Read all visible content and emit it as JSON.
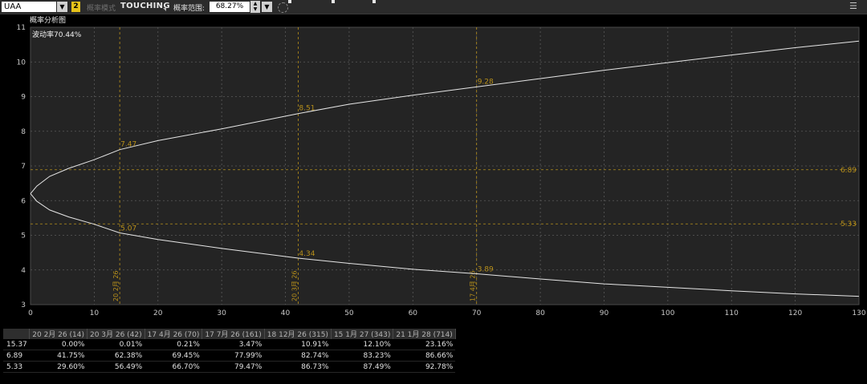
{
  "toolbar": {
    "symbol": "UAA",
    "badge": "2",
    "mode_label": "概率模式",
    "mode_value": "TOUCHING",
    "range_label": "概率范围:",
    "range_value": "68.27%"
  },
  "chart_title": "概率分析图",
  "chart_data": {
    "type": "line",
    "title": "概率分析图",
    "annotation": "波动率70.44%",
    "x_ticks": [
      0,
      10,
      20,
      30,
      40,
      50,
      60,
      70,
      80,
      90,
      100,
      110,
      120,
      130
    ],
    "y_ticks": [
      3,
      4,
      5,
      6,
      7,
      8,
      9,
      10,
      11
    ],
    "xlim": [
      0,
      130
    ],
    "ylim": [
      3,
      11
    ],
    "grid": true,
    "series": [
      {
        "values": [
          [
            0,
            6.2
          ],
          [
            1,
            6.42
          ],
          [
            3,
            6.7
          ],
          [
            6,
            6.93
          ],
          [
            10,
            7.18
          ],
          [
            14,
            7.47
          ],
          [
            20,
            7.73
          ],
          [
            30,
            8.07
          ],
          [
            42,
            8.51
          ],
          [
            50,
            8.78
          ],
          [
            60,
            9.04
          ],
          [
            70,
            9.28
          ],
          [
            80,
            9.52
          ],
          [
            90,
            9.76
          ],
          [
            100,
            9.98
          ],
          [
            110,
            10.2
          ],
          [
            120,
            10.41
          ],
          [
            130,
            10.6
          ]
        ]
      },
      {
        "values": [
          [
            0,
            6.2
          ],
          [
            1,
            5.98
          ],
          [
            3,
            5.73
          ],
          [
            6,
            5.53
          ],
          [
            10,
            5.32
          ],
          [
            14,
            5.07
          ],
          [
            20,
            4.88
          ],
          [
            30,
            4.62
          ],
          [
            42,
            4.34
          ],
          [
            50,
            4.19
          ],
          [
            60,
            4.02
          ],
          [
            70,
            3.89
          ],
          [
            80,
            3.74
          ],
          [
            90,
            3.6
          ],
          [
            100,
            3.5
          ],
          [
            110,
            3.4
          ],
          [
            120,
            3.31
          ],
          [
            130,
            3.24
          ]
        ]
      }
    ],
    "point_labels": [
      {
        "x": 14,
        "y": 7.47,
        "text": "7.47"
      },
      {
        "x": 14,
        "y": 5.07,
        "text": "5.07"
      },
      {
        "x": 42,
        "y": 8.51,
        "text": "8.51"
      },
      {
        "x": 42,
        "y": 4.34,
        "text": "4.34"
      },
      {
        "x": 70,
        "y": 9.28,
        "text": "9.28"
      },
      {
        "x": 70,
        "y": 3.89,
        "text": "3.89"
      }
    ],
    "h_lines": [
      {
        "y": 6.89,
        "text": "6.89"
      },
      {
        "y": 5.33,
        "text": "5.33"
      }
    ],
    "v_lines": [
      {
        "x": 14,
        "text": "20 2月 26"
      },
      {
        "x": 42,
        "text": "20 3月 26"
      },
      {
        "x": 70,
        "text": "17 4月 26"
      }
    ],
    "colors": {
      "curve": "#e6e6e6",
      "annotation": "#b8901a",
      "grid": "#5a5a5a",
      "plot_bg": "#242424"
    }
  },
  "table": {
    "headers": [
      "20 2月 26 (14)",
      "20 3月 26 (42)",
      "17 4月 26 (70)",
      "17 7月 26 (161)",
      "18 12月 26 (315)",
      "15 1月 27 (343)",
      "21 1月 28 (714)"
    ],
    "rows": [
      {
        "price": "15.37",
        "cells": [
          "0.00%",
          "0.01%",
          "0.21%",
          "3.47%",
          "10.91%",
          "12.10%",
          "23.16%"
        ]
      },
      {
        "price": "6.89",
        "cells": [
          "41.75%",
          "62.38%",
          "69.45%",
          "77.99%",
          "82.74%",
          "83.23%",
          "86.66%"
        ]
      },
      {
        "price": "5.33",
        "cells": [
          "29.60%",
          "56.49%",
          "66.70%",
          "79.47%",
          "86.73%",
          "87.49%",
          "92.78%"
        ]
      }
    ]
  }
}
